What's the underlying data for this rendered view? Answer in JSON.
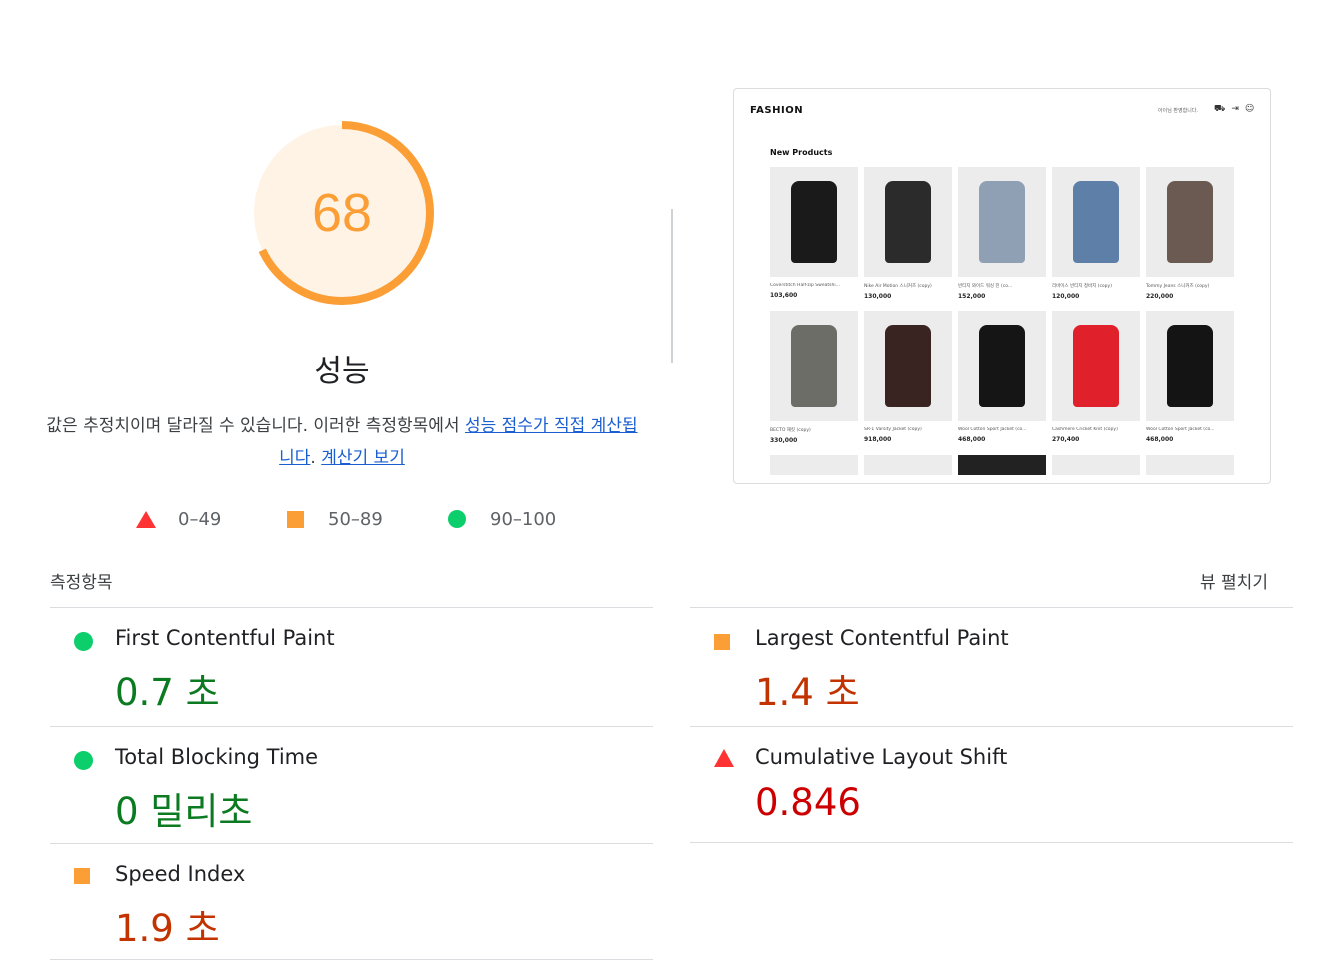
{
  "score": {
    "value": "68",
    "fraction": 0.68,
    "title": "성능",
    "colors": {
      "ring": "#fa9e35",
      "fill": "#fff3e6",
      "text": "#fa9e35"
    }
  },
  "description": {
    "text": "값은 추정치이며 달라질 수 있습니다. 이러한 측정항목에서 ",
    "link1": "성능 점수가 직접 계산됩니다",
    "separator": ". ",
    "link2": "계산기 보기"
  },
  "legend": [
    {
      "label": "0–49",
      "shape": "triangle-icon",
      "color": "#ff3333"
    },
    {
      "label": "50–89",
      "shape": "square-icon",
      "color": "#fa9e35"
    },
    {
      "label": "90–100",
      "shape": "circle-icon",
      "color": "#0cce6b"
    }
  ],
  "screenshot": {
    "logo": "FASHION",
    "greeting": "아이님 환영합니다.",
    "icons": [
      "cart-icon",
      "logout-icon",
      "user-icon"
    ],
    "section": "New Products",
    "products": [
      {
        "name": "Coverstitch Half-zip Sweatshi...",
        "price": "103,600",
        "color": "#1a1a1a"
      },
      {
        "name": "Nike Air Motion 스니커즈 (copy)",
        "price": "130,000",
        "color": "#2b2b2b"
      },
      {
        "name": "빈티지 와이드 워싱 진 (co...",
        "price": "152,000",
        "color": "#8fa0b5"
      },
      {
        "name": "리바이스 빈티지 청바지 (copy)",
        "price": "120,000",
        "color": "#5d7fa8"
      },
      {
        "name": "Tommy Jeans 스니커즈 (copy)",
        "price": "220,000",
        "color": "#6a5a52"
      },
      {
        "name": "BECTO 재킷 (copy)",
        "price": "330,000",
        "color": "#6b6d66"
      },
      {
        "name": "SR-1 Varsity Jacket (copy)",
        "price": "918,000",
        "color": "#3a2422"
      },
      {
        "name": "Wool Cotton Sport Jacket (co...",
        "price": "468,000",
        "color": "#151515"
      },
      {
        "name": "Cashmere Cricket Knit (copy)",
        "price": "270,400",
        "color": "#e0202a"
      },
      {
        "name": "Wool Cotton Sport Jacket (co...",
        "price": "468,000",
        "color": "#141414"
      }
    ]
  },
  "metrics": {
    "label": "측정항목",
    "expand": "뷰 펼치기",
    "items": [
      {
        "name": "First Contentful Paint",
        "value": "0.7 초",
        "status": "pass"
      },
      {
        "name": "Largest Contentful Paint",
        "value": "1.4 초",
        "status": "average"
      },
      {
        "name": "Total Blocking Time",
        "value": "0 밀리초",
        "status": "pass"
      },
      {
        "name": "Cumulative Layout Shift",
        "value": "0.846",
        "status": "fail"
      },
      {
        "name": "Speed Index",
        "value": "1.9 초",
        "status": "average"
      }
    ]
  }
}
